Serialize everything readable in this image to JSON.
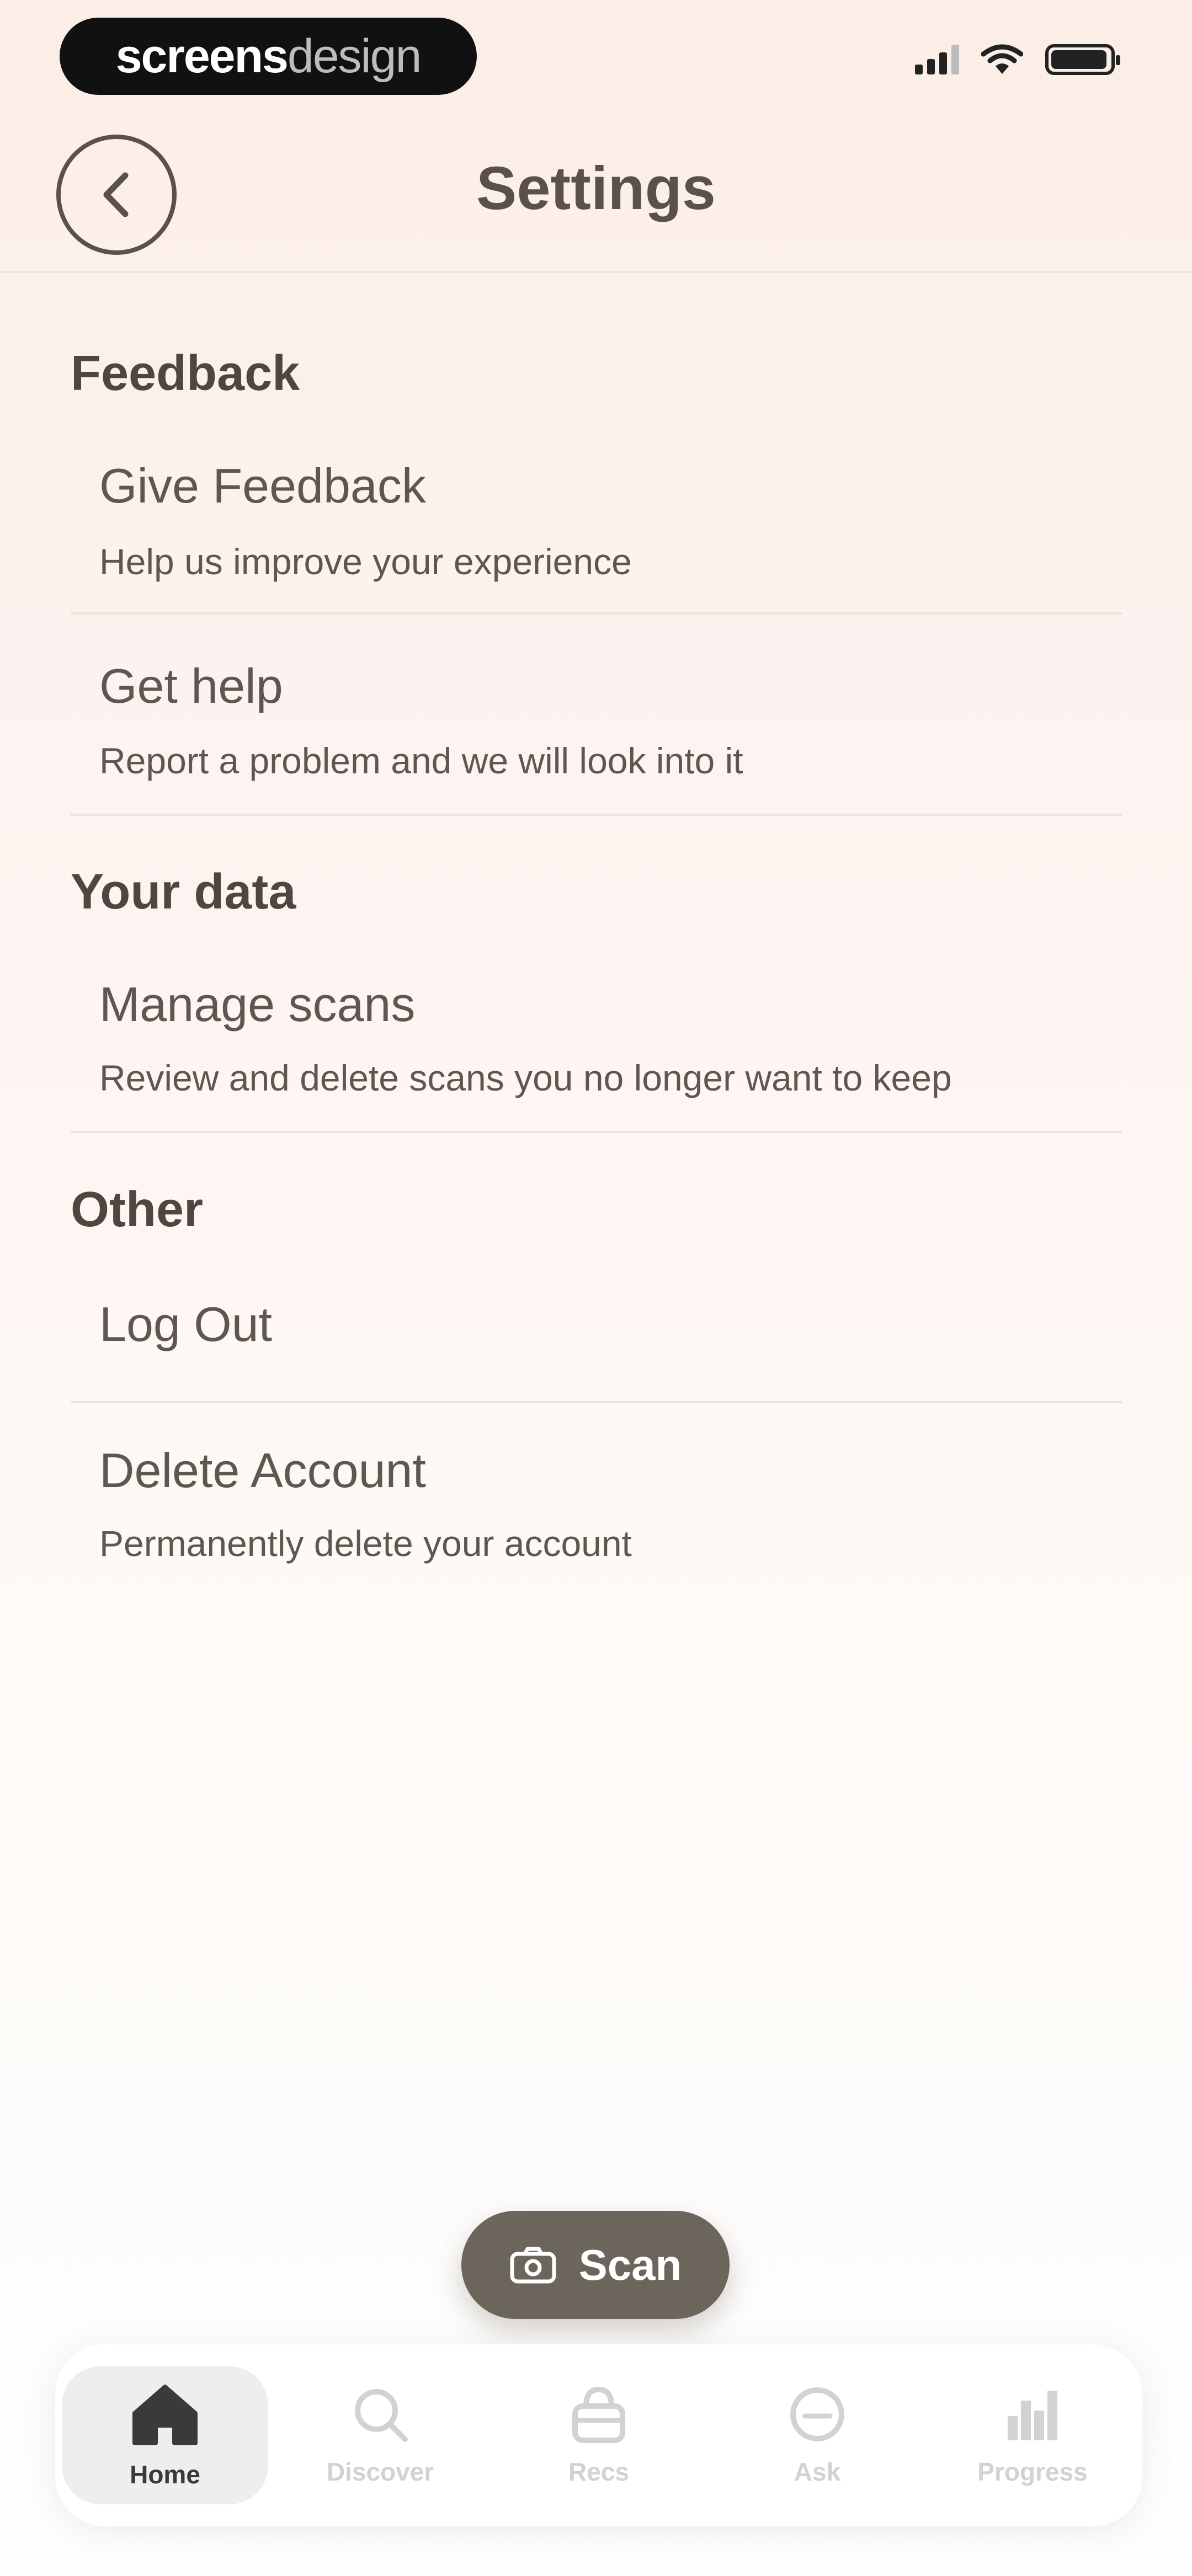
{
  "status_bar": {
    "brand_bold": "screens",
    "brand_light": "design"
  },
  "header": {
    "title": "Settings",
    "back_icon": "chevron-left-icon"
  },
  "sections": [
    {
      "heading": "Feedback",
      "items": [
        {
          "title": "Give Feedback",
          "subtitle": "Help us improve your experience"
        },
        {
          "title": "Get help",
          "subtitle": "Report a problem and we will look into it"
        }
      ]
    },
    {
      "heading": "Your data",
      "items": [
        {
          "title": "Manage scans",
          "subtitle": "Review and delete scans you no longer want to keep"
        }
      ]
    },
    {
      "heading": "Other",
      "items": [
        {
          "title": "Log Out"
        },
        {
          "title": "Delete Account",
          "subtitle": "Permanently delete your account"
        }
      ]
    }
  ],
  "scan_button": {
    "label": "Scan",
    "icon": "camera-icon"
  },
  "tab_bar": {
    "active": "Home",
    "tabs": [
      {
        "label": "Home",
        "icon": "home-icon"
      },
      {
        "label": "Discover",
        "icon": "search-icon"
      },
      {
        "label": "Recs",
        "icon": "bag-icon"
      },
      {
        "label": "Ask",
        "icon": "chat-icon"
      },
      {
        "label": "Progress",
        "icon": "bar-chart-icon"
      }
    ]
  },
  "colors": {
    "text": "#5a524a",
    "scan_button": "#6b655c",
    "tab_active_bg": "#eeeeee"
  }
}
